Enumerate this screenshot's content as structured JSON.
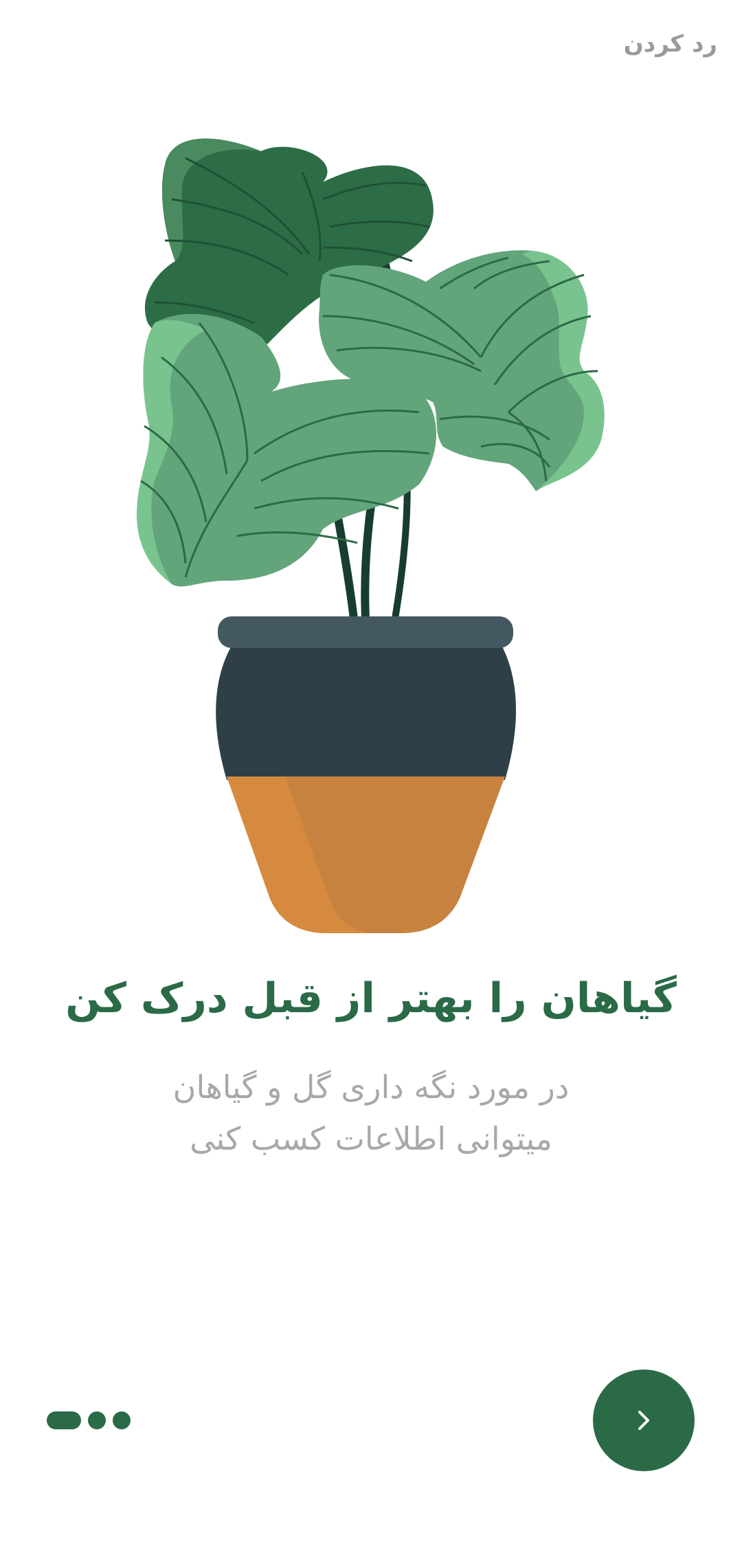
{
  "header": {
    "skip_label": "رد کردن"
  },
  "onboarding": {
    "title": "گیاهان را بهتر از قبل درک کن",
    "subtitle_line1": "در مورد نگه داری گل و گیاهان",
    "subtitle_line2": "میتوانی اطلاعات کسب کنی"
  },
  "pagination": {
    "total": 3,
    "active_index": 0
  },
  "next_button": {
    "icon": "chevron-right-icon"
  },
  "colors": {
    "accent": "#2b6a47",
    "muted_text": "#a8a8a8",
    "skip_text": "#9a9a9a",
    "pot_dark": "#2e3f48",
    "pot_rim": "#445862",
    "pot_orange": "#d58a41"
  }
}
